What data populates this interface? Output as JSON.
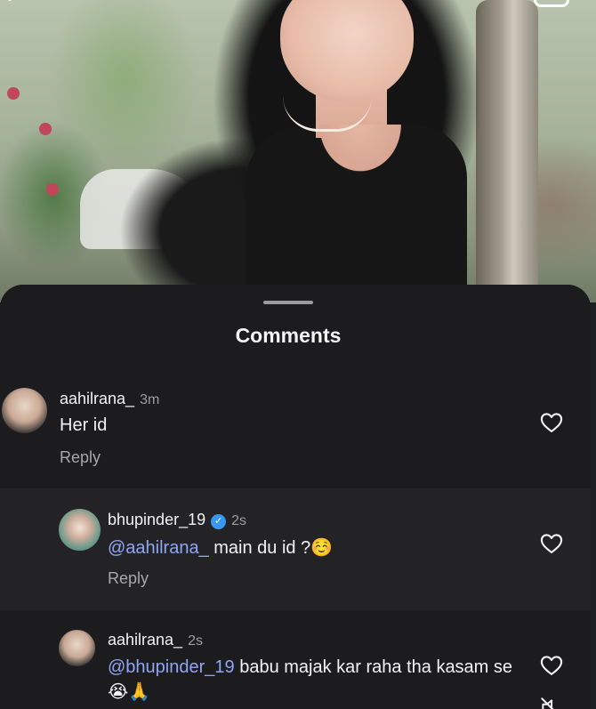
{
  "sheet": {
    "title": "Comments"
  },
  "comments": [
    {
      "username": "aahilrana_",
      "time": "3m",
      "text": "Her id",
      "reply_label": "Reply"
    },
    {
      "username": "bhupinder_19",
      "verified": true,
      "time": "2s",
      "mention": "@aahilrana_",
      "text": " main du id ?",
      "emoji": "☺️",
      "reply_label": "Reply"
    },
    {
      "username": "aahilrana_",
      "time": "2s",
      "mention": "@bhupinder_19",
      "text": " babu majak kar raha tha kasam se ",
      "emoji": "😭🙏"
    }
  ],
  "icons": {
    "back": "chevron-left-icon",
    "camera": "camera-icon",
    "like": "heart-outline-icon",
    "mute": "speaker-muted-icon",
    "verified": "verified-badge-icon"
  },
  "colors": {
    "sheet_bg": "#232326",
    "mention": "#8fa6f5",
    "verified": "#3897f0",
    "secondary_text": "#a8a8a8"
  }
}
